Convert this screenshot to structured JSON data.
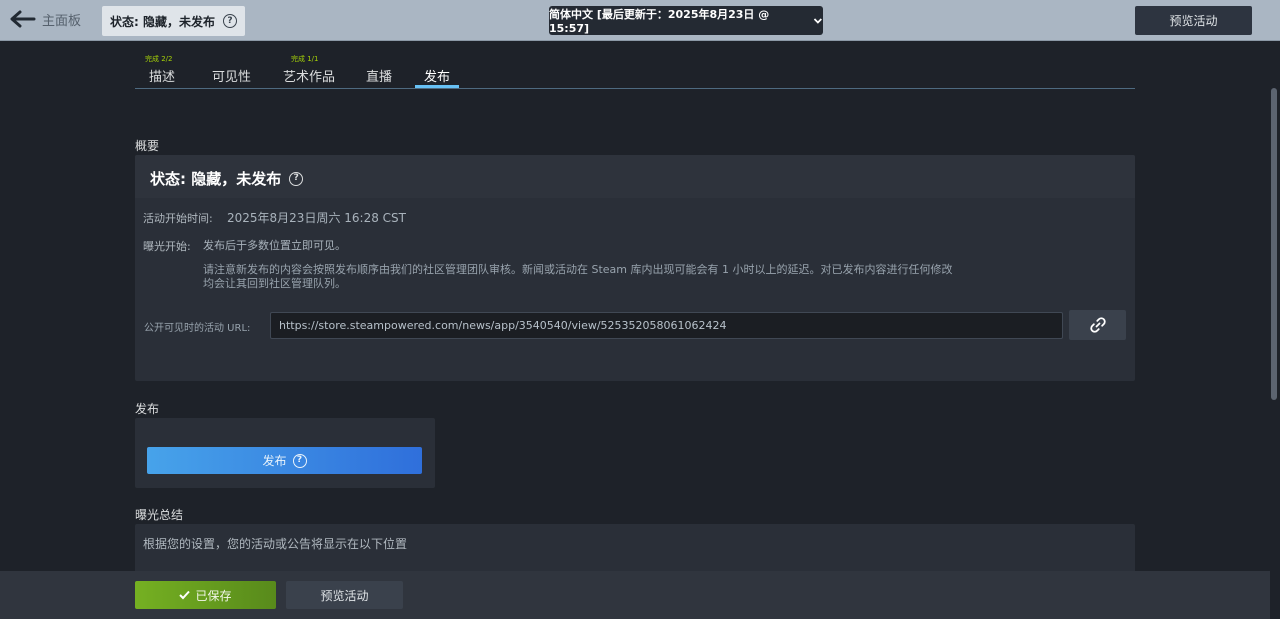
{
  "topbar": {
    "back_label": "主面板",
    "status": "状态: 隐藏，未发布",
    "help_glyph": "?",
    "language_select": "简体中文 [最后更新于：2025年8月23日 @ 15:57]",
    "preview_label": "预览活动"
  },
  "tabs": [
    {
      "label": "描述",
      "done": "完成 2/2"
    },
    {
      "label": "可见性",
      "done": ""
    },
    {
      "label": "艺术作品",
      "done": "完成 1/1"
    },
    {
      "label": "直播",
      "done": ""
    },
    {
      "label": "发布",
      "done": ""
    }
  ],
  "overview": {
    "section_title": "概要",
    "status_title": "状态: 隐藏，未发布",
    "start_time_label": "活动开始时间:",
    "start_time_value": "2025年8月23日周六 16:28 CST",
    "exposure_label": "曝光开始:",
    "exposure_value": "发布后于多数位置立即可见。",
    "note": "请注意新发布的内容会按照发布顺序由我们的社区管理团队审核。新闻或活动在 Steam 库内出现可能会有 1 小时以上的延迟。对已发布内容进行任何修改均会让其回到社区管理队列。",
    "url_label": "公开可见时的活动 URL:",
    "url_value": "https://store.steampowered.com/news/app/3540540/view/525352058061062424"
  },
  "publish": {
    "section_title": "发布",
    "button_label": "发布"
  },
  "summary": {
    "section_title": "曝光总结",
    "text": "根据您的设置，您的活动或公告将显示在以下位置"
  },
  "bottombar": {
    "saved_label": "已保存",
    "preview_label": "预览活动"
  },
  "colors": {
    "accent_blue": "#67c1f5",
    "done_green": "#a4d007",
    "saved_green": "#75b022"
  }
}
